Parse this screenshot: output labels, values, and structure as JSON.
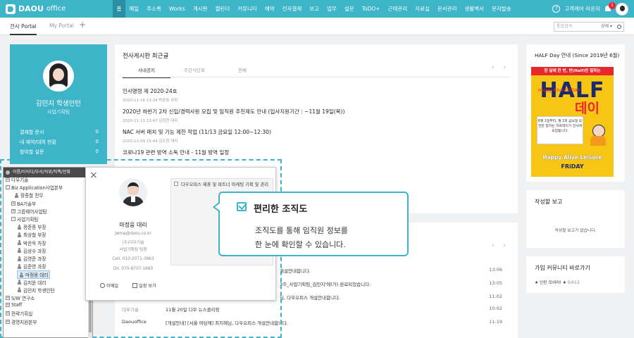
{
  "topbar": {
    "brand": "DAOU",
    "brand_sub": "office",
    "nav": [
      "홈",
      "메일",
      "주소록",
      "Works",
      "게시판",
      "캘린더",
      "커뮤니티",
      "예약",
      "전자결재",
      "보고",
      "업무",
      "설문",
      "ToDO+",
      "근태관리",
      "자료실",
      "문서관리",
      "생활백서",
      "문자발송"
    ],
    "active_nav": "홈",
    "help_label": "고객케어 라운지",
    "help_icon": "question-icon",
    "notify_icon": "bell-icon",
    "notify_count": "1"
  },
  "tabs": {
    "portal_active": "전사 Portal",
    "portal_other": "My Portal",
    "add": "+",
    "search_placeholder": "통합검색",
    "search_option": "상세 ▾"
  },
  "profile": {
    "name": "김민지 학생인턴",
    "dept": "사업기획팀",
    "stats": [
      {
        "label": "결재할 문서",
        "value": "0"
      },
      {
        "label": "내 예약/대여 현황",
        "value": "0"
      },
      {
        "label": "참여할 설문",
        "value": "0"
      }
    ]
  },
  "board": {
    "title": "전사게시판 최근글",
    "tabs": [
      "사내공지",
      "주간식단표",
      "전체"
    ],
    "nav": "‹ ›",
    "posts": [
      {
        "title": "인사명령 제 2020-24호",
        "meta": "2020-11-16 13:24   박윤호 차장"
      },
      {
        "title": "2020년 하반기 2차 신입/경력사원 모집 및 임직원 추천제도 안내 (입사지원기간 : ~11월 19일(목))",
        "meta": "2020-11-11 13:47   김정현 대리"
      },
      {
        "title": "NAC 서버 패치 및 기능 제한 작업 (11/13 금요일 12:00~12:30)",
        "meta": "2020-11-09 15:44   김도현 대리"
      },
      {
        "title": "코로나19 관련 방역 소독 안내 - 11월 방역 일정",
        "meta": ""
      }
    ]
  },
  "activity": {
    "nav": "‹ ›",
    "rows": [
      {
        "who": "",
        "msg": "개설안내합니다.",
        "time": "13:06"
      },
      {
        "who": "",
        "msg": "3주_사업기획팀_김민지'에(가) 완료되었습니다.",
        "time": "13:05"
      },
      {
        "who": "",
        "msg": "님, 다우오피스 개설안내합니다.",
        "time": "11:02"
      },
      {
        "who": "다우기술",
        "msg": "11월 20일 다우 뉴스클리핑",
        "time": "10:02"
      },
      {
        "who": "Daouoffice",
        "msg": "[개설안내] [서울 여담재] 최지혜님, 다우오피스 개설안내합니다.",
        "time": "11-19"
      }
    ]
  },
  "halfday": {
    "title": "HALF Day 안내 (Since 2019년 6월)",
    "banner_top": "한 달에 한 번, 반(Half)만 일하는",
    "banner_half": "HALF",
    "banner_script": "Happy Alive FRIDAY",
    "banner_day": "데이",
    "banner_note": "6월 1일부터, 월 1회 금요일 오전만 일하는 하프데이가 전사에 도입됩니다.",
    "banner_happy": "Happy Alive Leisure",
    "banner_friday": "FRiDAY"
  },
  "written": {
    "title": "작성할 보고",
    "empty": "작성할 보고가 없습니다."
  },
  "community": {
    "title": "가입 커뮤니티 바로가기",
    "item": "★ 인턴 모여라! ★",
    "count": "0/413"
  },
  "org": {
    "search_label": "이름/아이디/부서/직위/직책/전화",
    "nodes": [
      {
        "label": "다우기술",
        "type": "group"
      },
      {
        "label": "Biz Application사업본부",
        "type": "group"
      },
      {
        "label": "장종철 전무",
        "type": "person"
      },
      {
        "label": "BA기술부",
        "type": "group"
      },
      {
        "label": "그룹웨어사업팀",
        "type": "group"
      },
      {
        "label": "사업기획팀",
        "type": "group"
      },
      {
        "label": "정준종 부장",
        "type": "person"
      },
      {
        "label": "최상철 부장",
        "type": "person"
      },
      {
        "label": "박찬옥 차장",
        "type": "person"
      },
      {
        "label": "김상수 과장",
        "type": "person"
      },
      {
        "label": "김영준 과장",
        "type": "person"
      },
      {
        "label": "김준영 과장",
        "type": "person"
      },
      {
        "label": "마정웅 대리",
        "type": "person"
      },
      {
        "label": "김지윤 대리",
        "type": "person"
      },
      {
        "label": "김민지 학생인턴",
        "type": "person"
      },
      {
        "label": "S/W 연구소",
        "type": "group"
      },
      {
        "label": "Staff",
        "type": "group"
      },
      {
        "label": "전략기획실",
        "type": "group"
      },
      {
        "label": "경영지원본부",
        "type": "group"
      }
    ]
  },
  "user_card": {
    "name": "마정웅 대리",
    "email": "jwma@daou.co.kr",
    "company": "(주)다우기술",
    "dept": "사업기획팀 팀원",
    "cell": "Cell. 010-2071-3863",
    "dir": "Dir. 070-8707-1660",
    "action_mail": "이메일",
    "action_schedule": "일정 보기",
    "duty": "다우오피스 제휴 및 파트너 마케팅 기획 및 관리"
  },
  "callout": {
    "title": "편리한 조직도",
    "line1": "조직도를 통해 임직원 정보를",
    "line2": "한 눈에 확인할 수 있습니다."
  },
  "colors": {
    "accent": "#3db4c8",
    "nav_active": "#2a8fa3",
    "badge": "#ee2233"
  }
}
